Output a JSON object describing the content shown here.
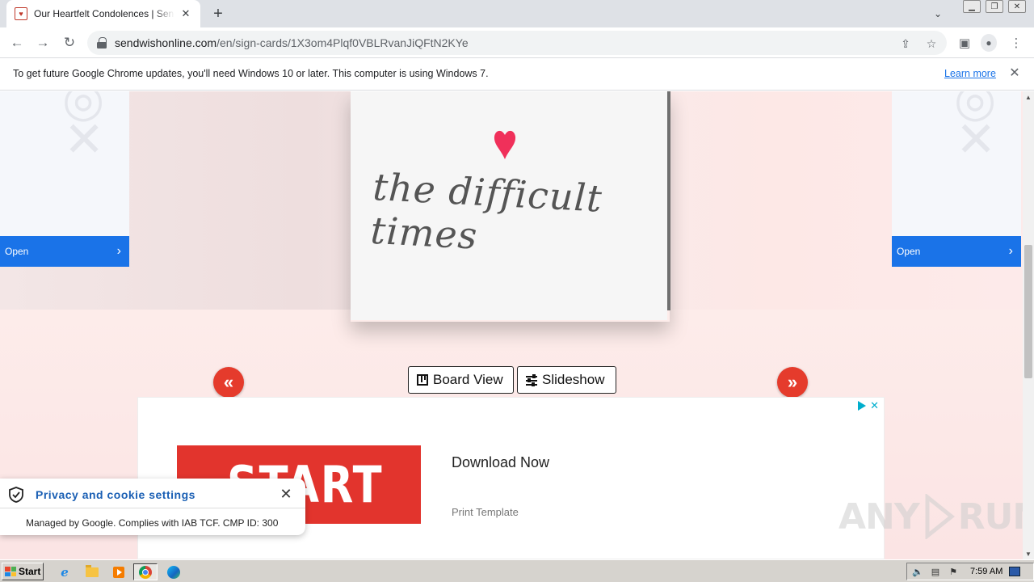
{
  "browser": {
    "tab": {
      "title": "Our Heartfelt Condolences | Sendwishonline",
      "favicon": "card-favicon"
    },
    "new_tab_symbol": "+",
    "url": {
      "host": "sendwishonline.com",
      "path": "/en/sign-cards/1X3om4Plqf0VBLRvanJiQFtN2KYe"
    },
    "infobar": {
      "message": "To get future Google Chrome updates, you'll need Windows 10 or later. This computer is using Windows 7.",
      "link": "Learn more"
    }
  },
  "page": {
    "side_ads": {
      "left_button": "Open",
      "right_button": "Open"
    },
    "card": {
      "script_text": "the difficult times",
      "heart_color": "#f0305a"
    },
    "controls": {
      "prev_symbol": "«",
      "next_symbol": "»",
      "board_view": "Board View",
      "slideshow": "Slideshow"
    },
    "ad": {
      "image_text": "START",
      "title": "Download Now",
      "subtitle": "Print Template"
    },
    "watermark": {
      "left": "ANY",
      "right": "RUN"
    },
    "cookie": {
      "title": "Privacy and cookie settings",
      "text": "Managed by Google. Complies with IAB TCF. CMP ID: 300"
    }
  },
  "taskbar": {
    "start": "Start",
    "clock": "7:59 AM"
  },
  "colors": {
    "accent_red": "#e53b2c",
    "link_blue": "#1a73e8",
    "ad_button_blue": "#1a73e8"
  }
}
